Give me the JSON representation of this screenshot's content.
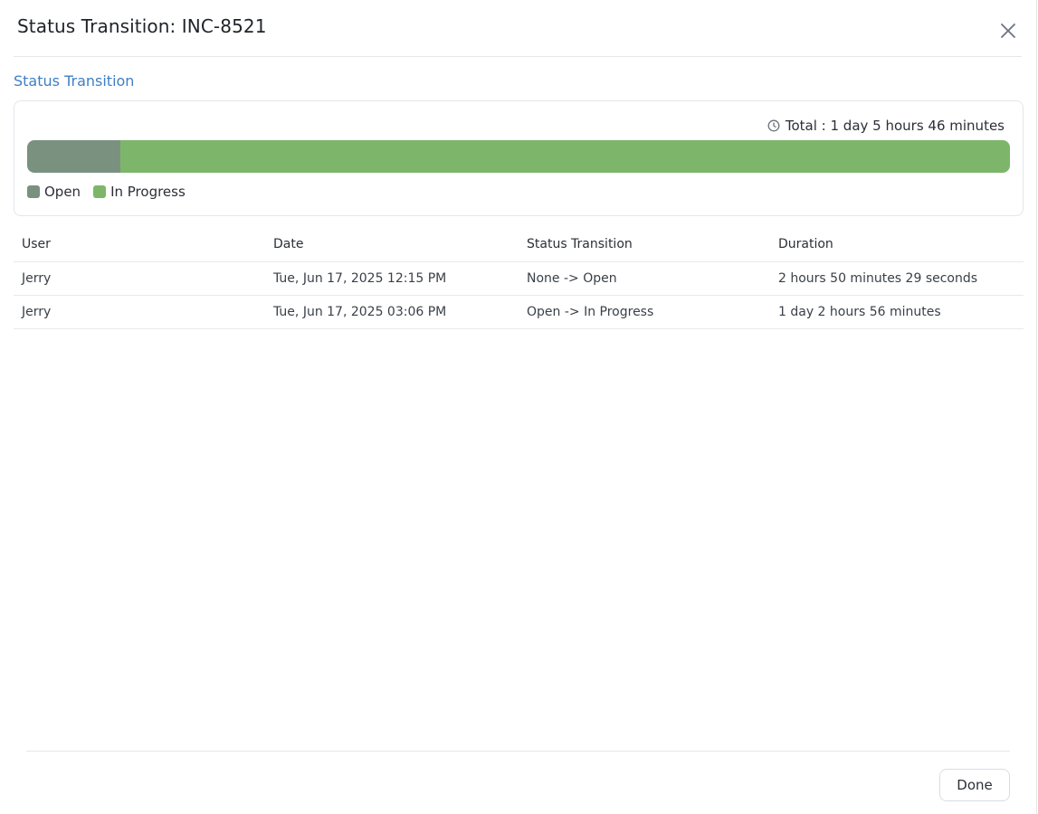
{
  "dialog": {
    "title": "Status Transition: INC-8521",
    "close_icon": "close-icon"
  },
  "section": {
    "title": "Status Transition"
  },
  "summary": {
    "total_label": "Total : 1 day 5 hours 46 minutes",
    "clock_icon": "clock-icon",
    "segments": [
      {
        "label": "Open",
        "color": "#7a9180",
        "fraction": 0.0952
      },
      {
        "label": "In Progress",
        "color": "#7db66a",
        "fraction": 0.9048
      }
    ]
  },
  "table": {
    "headers": [
      "User",
      "Date",
      "Status Transition",
      "Duration"
    ],
    "rows": [
      {
        "user": "Jerry",
        "date": "Tue, Jun 17, 2025 12:15 PM",
        "transition": "None -> Open",
        "duration": "2 hours 50 minutes 29 seconds"
      },
      {
        "user": "Jerry",
        "date": "Tue, Jun 17, 2025 03:06 PM",
        "transition": "Open -> In Progress",
        "duration": "1 day 2 hours 56 minutes"
      }
    ]
  },
  "footer": {
    "done_label": "Done"
  }
}
